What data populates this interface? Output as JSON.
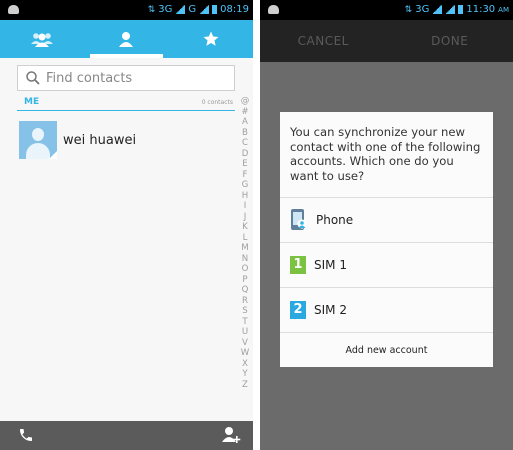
{
  "left": {
    "status": {
      "signal1": "3G",
      "signal2": "G",
      "time": "08:19"
    },
    "tabs": [
      {
        "name": "groups",
        "icon": "groups-icon",
        "active": false
      },
      {
        "name": "contacts",
        "icon": "person-icon",
        "active": true
      },
      {
        "name": "favorites",
        "icon": "star-icon",
        "active": false
      }
    ],
    "search": {
      "placeholder": "Find contacts"
    },
    "section": {
      "label": "ME",
      "count": "0 contacts"
    },
    "contact": {
      "name": "wei huawei"
    },
    "alphabet": [
      "@",
      "#",
      "A",
      "B",
      "C",
      "D",
      "E",
      "F",
      "G",
      "H",
      "I",
      "J",
      "K",
      "L",
      "M",
      "N",
      "O",
      "P",
      "Q",
      "R",
      "S",
      "T",
      "U",
      "V",
      "W",
      "X",
      "Y",
      "Z"
    ],
    "bottom": {
      "left_icon": "phone-icon",
      "right_icon": "add-contact-icon"
    }
  },
  "right": {
    "status": {
      "signal": "3G",
      "time": "11:30",
      "ampm": "AM"
    },
    "actions": {
      "cancel": "CANCEL",
      "done": "DONE"
    },
    "dialog": {
      "message": "You can synchronize your new contact with one of the following accounts. Which one do you want to use?",
      "options": [
        {
          "label": "Phone",
          "icon": "phone-account-icon"
        },
        {
          "label": "SIM 1",
          "icon": "sim1-icon",
          "badge": "1"
        },
        {
          "label": "SIM 2",
          "icon": "sim2-icon",
          "badge": "2"
        }
      ],
      "add_account": "Add new account"
    }
  },
  "colors": {
    "accent": "#33b5e5",
    "sim1": "#7cc242",
    "sim2": "#2aa9e0"
  }
}
